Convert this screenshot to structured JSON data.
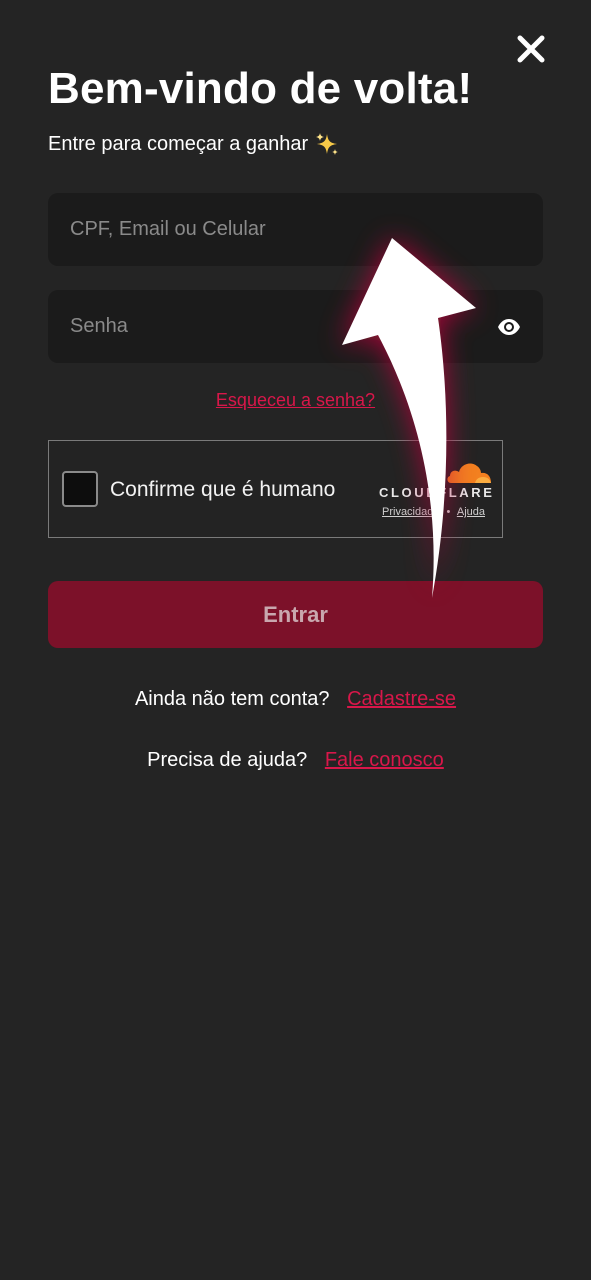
{
  "header": {
    "title": "Bem-vindo de volta!",
    "subtitle": "Entre para começar a ganhar",
    "subtitle_icon": "sparkles-icon"
  },
  "form": {
    "identifier_placeholder": "CPF, Email ou Celular",
    "identifier_value": "",
    "password_placeholder": "Senha",
    "password_value": "",
    "forgot_password": "Esqueceu a senha?",
    "submit_label": "Entrar"
  },
  "captcha": {
    "label": "Confirme que é humano",
    "checked": false,
    "brand": "CLOUDFLARE",
    "privacy_link": "Privacidade",
    "separator": "•",
    "help_link": "Ajuda"
  },
  "footer": {
    "signup_question": "Ainda não tem conta?",
    "signup_link": "Cadastre-se",
    "help_question": "Precisa de ajuda?",
    "help_link": "Fale conosco"
  },
  "colors": {
    "background": "#242424",
    "input_background": "#1b1b1b",
    "accent": "#d8174a",
    "button": "#7c1129",
    "cloudflare_orange": "#f38020"
  }
}
